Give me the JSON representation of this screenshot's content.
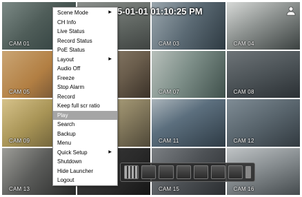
{
  "header": {
    "timestamp": "5-01-01 01:10:25 PM"
  },
  "cameras": [
    {
      "label": "CAM 01",
      "bg": "linear-gradient(135deg,#7c8a86 0%,#4f5d59 45%,#2c3b3a 100%)"
    },
    {
      "label": "",
      "bg": "linear-gradient(160deg,#8b8f8c 0%,#5c625e 60%,#3f4341 100%)"
    },
    {
      "label": "CAM 03",
      "bg": "linear-gradient(120deg,#9aa6ad 0%,#5b6a74 50%,#2e3a42 100%)"
    },
    {
      "label": "CAM 04",
      "bg": "linear-gradient(150deg,#d7d9d7 0%,#8d9290 45%,#3b4140 100%)"
    },
    {
      "label": "CAM 05",
      "bg": "linear-gradient(135deg,#caa574 0%,#b27f43 50%,#5b4430 100%)"
    },
    {
      "label": "",
      "bg": "linear-gradient(135deg,#9c8e7a 0%,#6a5d4c 60%,#3a3128 100%)"
    },
    {
      "label": "CAM 07",
      "bg": "linear-gradient(120deg,#b8c0bb 0%,#7e8f89 45%,#3f504b 100%)"
    },
    {
      "label": "CAM 08",
      "bg": "linear-gradient(160deg,#6e7478 0%,#4c5357 50%,#2b3034 100%)"
    },
    {
      "label": "CAM 09",
      "bg": "linear-gradient(140deg,#d6c28a 0%,#a89456 45%,#5b5030 100%)"
    },
    {
      "label": "",
      "bg": "linear-gradient(140deg,#c4b98f 0%,#8f8465 50%,#4f4838 100%)"
    },
    {
      "label": "CAM 11",
      "bg": "linear-gradient(150deg,#aab4ba 0%,#5c6f7e 40%,#2e3b45 100%)"
    },
    {
      "label": "CAM 12",
      "bg": "linear-gradient(150deg,#7f8c95 0%,#58646c 50%,#323a40 100%)"
    },
    {
      "label": "CAM 13",
      "bg": "linear-gradient(130deg,#9d9d98 0%,#5b5c5a 45%,#272827 100%)"
    },
    {
      "label": "",
      "bg": "linear-gradient(130deg,#3c3c3c 0%,#2a2a2a 60%,#161616 100%)"
    },
    {
      "label": "CAM 15",
      "bg": "linear-gradient(130deg,#7b7f83 0%,#4d5155 50%,#2b2e31 100%)"
    },
    {
      "label": "CAM 16",
      "bg": "linear-gradient(160deg,#bfc3c5 0%,#888e91 45%,#454b4e 100%)"
    }
  ],
  "menu": {
    "items": [
      {
        "label": "Scene Mode",
        "submenu": true,
        "highlight": false
      },
      {
        "label": "CH Info",
        "submenu": false,
        "highlight": false
      },
      {
        "label": "Live Status",
        "submenu": false,
        "highlight": false
      },
      {
        "label": "Record Status",
        "submenu": false,
        "highlight": false
      },
      {
        "label": "PoE Status",
        "submenu": false,
        "highlight": false
      },
      {
        "label": "Layout",
        "submenu": true,
        "highlight": false
      },
      {
        "label": "Audio Off",
        "submenu": false,
        "highlight": false
      },
      {
        "label": "Freeze",
        "submenu": false,
        "highlight": false
      },
      {
        "label": "Stop Alarm",
        "submenu": false,
        "highlight": false
      },
      {
        "label": "Record",
        "submenu": false,
        "highlight": false
      },
      {
        "label": "Keep full scr ratio",
        "submenu": false,
        "highlight": false
      },
      {
        "label": "Play",
        "submenu": false,
        "highlight": true
      },
      {
        "label": "Search",
        "submenu": false,
        "highlight": false
      },
      {
        "label": "Backup",
        "submenu": false,
        "highlight": false
      },
      {
        "label": "Menu",
        "submenu": false,
        "highlight": false
      },
      {
        "label": "Quick Setup",
        "submenu": true,
        "highlight": false
      },
      {
        "label": "Shutdown",
        "submenu": false,
        "highlight": false
      },
      {
        "label": "Hide Launcher",
        "submenu": false,
        "highlight": false
      },
      {
        "label": "Logout",
        "submenu": false,
        "highlight": false
      }
    ],
    "submenu_arrow": "▶"
  },
  "launcher": {
    "button_count": 7
  },
  "icons": {
    "user": "user-icon"
  }
}
